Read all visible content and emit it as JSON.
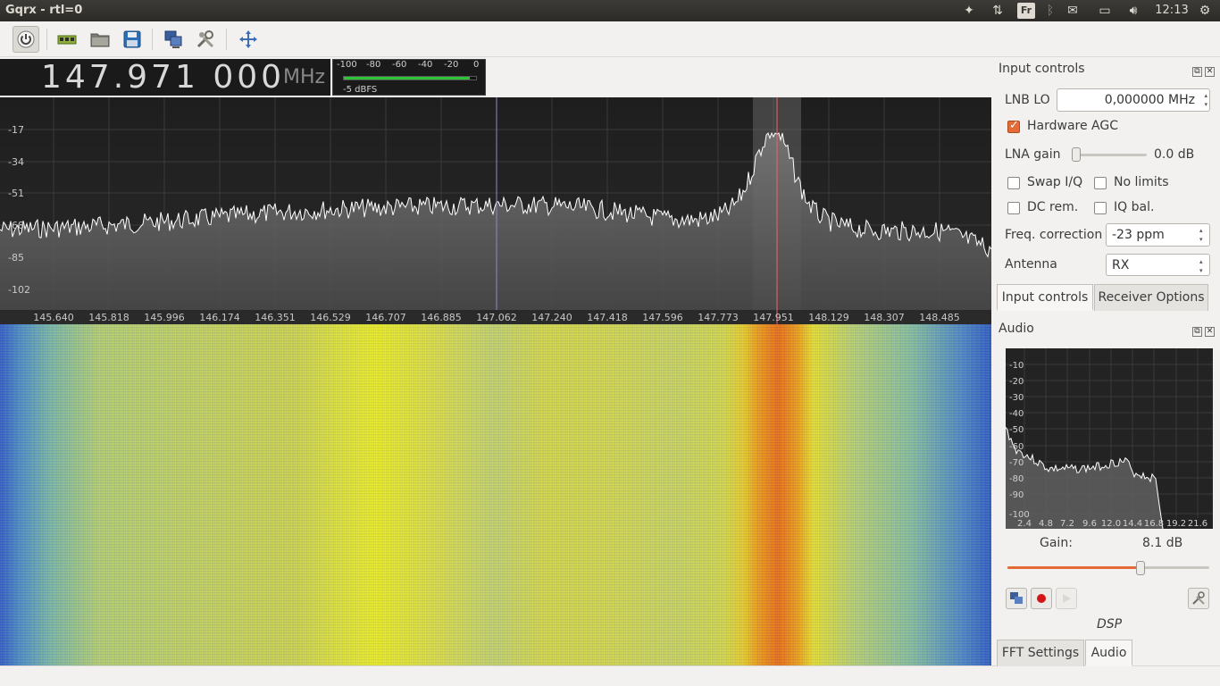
{
  "app": {
    "title": "Gqrx - rtl=0"
  },
  "panel": {
    "keyboard": "Fr",
    "clock": "12:13"
  },
  "toolbar": {
    "buttons": [
      "power-icon",
      "rtl-device-icon",
      "open-folder-icon",
      "save-icon",
      "remote-control-icon",
      "configure-tools-icon",
      "fullscreen-arrows-icon"
    ]
  },
  "frequency": {
    "value": "147.971 000",
    "unit": "MHz"
  },
  "signal_meter": {
    "scale": [
      "-100",
      "-80",
      "-60",
      "-40",
      "-20",
      "0"
    ],
    "level_fraction": 0.95,
    "reading": "-5 dBFS"
  },
  "spectrum": {
    "db_labels": [
      "-17",
      "-34",
      "-51",
      "-68",
      "-85",
      "-102"
    ],
    "freq_labels": [
      "145.640",
      "145.818",
      "145.996",
      "146.174",
      "146.351",
      "146.529",
      "146.707",
      "146.885",
      "147.062",
      "147.240",
      "147.418",
      "147.596",
      "147.773",
      "147.951",
      "148.129",
      "148.307",
      "148.485"
    ],
    "colors": {
      "trace": "#ffffff",
      "filter": "#8a8a8a",
      "demod_line": "#ff6060",
      "center_line": "#8d8dc8"
    }
  },
  "input_controls": {
    "title": "Input controls",
    "lnb_lo_label": "LNB LO",
    "lnb_lo_value": "0,000000 MHz",
    "hw_agc_label": "Hardware AGC",
    "hw_agc_checked": true,
    "lna_label": "LNA gain",
    "lna_value": "0.0 dB",
    "swap_iq_label": "Swap I/Q",
    "no_limits_label": "No limits",
    "dc_rem_label": "DC rem.",
    "iq_bal_label": "IQ bal.",
    "freq_corr_label": "Freq. correction",
    "freq_corr_value": "-23 ppm",
    "antenna_label": "Antenna",
    "antenna_value": "RX"
  },
  "dock_tabs_top": [
    "Input controls",
    "Receiver Options"
  ],
  "audio": {
    "title": "Audio",
    "db_labels": [
      "-10",
      "-20",
      "-30",
      "-40",
      "-50",
      "-60",
      "-70",
      "-80",
      "-90",
      "-100"
    ],
    "freq_labels": [
      "2.4",
      "4.8",
      "7.2",
      "9.6",
      "12.0",
      "14.4",
      "16.8",
      "19.2",
      "21.6"
    ],
    "gain_label": "Gain:",
    "gain_value": "8.1 dB",
    "gain_fraction": 0.66,
    "dsp_label": "DSP",
    "accent": "#e46a38"
  },
  "dock_tabs_bottom": [
    "FFT Settings",
    "Audio"
  ]
}
